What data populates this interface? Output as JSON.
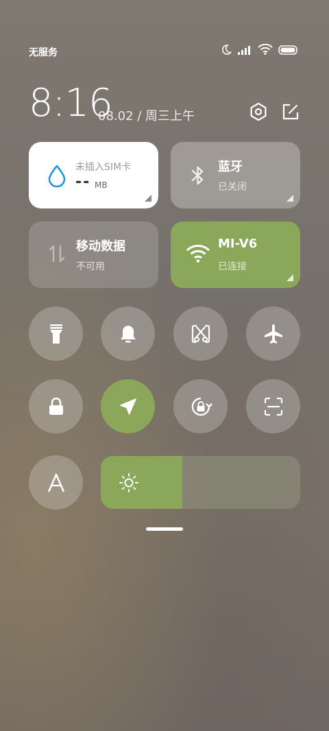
{
  "status_bar": {
    "carrier": "无服务",
    "icons": [
      "moon-icon",
      "signal-icon",
      "wifi-icon",
      "battery-icon"
    ]
  },
  "header": {
    "time": "8:16",
    "date": "08.02 / 周三上午",
    "icons": [
      "settings-icon",
      "edit-icon"
    ]
  },
  "tiles": {
    "data_usage": {
      "title": "未插入SIM卡",
      "value": "--",
      "unit": "MB",
      "icon": "water-drop-icon"
    },
    "bluetooth": {
      "title": "蓝牙",
      "status": "已关闭",
      "icon": "bluetooth-icon"
    },
    "mobile_data": {
      "title": "移动数据",
      "status": "不可用",
      "icon": "data-arrows-icon"
    },
    "wifi": {
      "title": "MI-V6",
      "status": "已连接",
      "icon": "wifi-icon"
    }
  },
  "toggles": [
    {
      "name": "flashlight",
      "icon": "flashlight-icon",
      "active": false
    },
    {
      "name": "ringer",
      "icon": "bell-icon",
      "active": false
    },
    {
      "name": "screenshot",
      "icon": "scissors-icon",
      "active": false
    },
    {
      "name": "airplane-mode",
      "icon": "airplane-icon",
      "active": false
    },
    {
      "name": "lock-screen",
      "icon": "lock-icon",
      "active": false
    },
    {
      "name": "location",
      "icon": "location-arrow-icon",
      "active": true
    },
    {
      "name": "rotation-lock",
      "icon": "rotation-lock-icon",
      "active": false
    },
    {
      "name": "scanner",
      "icon": "scan-icon",
      "active": false
    },
    {
      "name": "font",
      "icon": "font-a-icon",
      "active": false
    }
  ],
  "brightness": {
    "level_fraction": 0.41,
    "icon": "sun-icon"
  },
  "colors": {
    "accent": "#8aa75a",
    "white_tile": "#ffffff",
    "water_drop": "#1e96e0"
  }
}
